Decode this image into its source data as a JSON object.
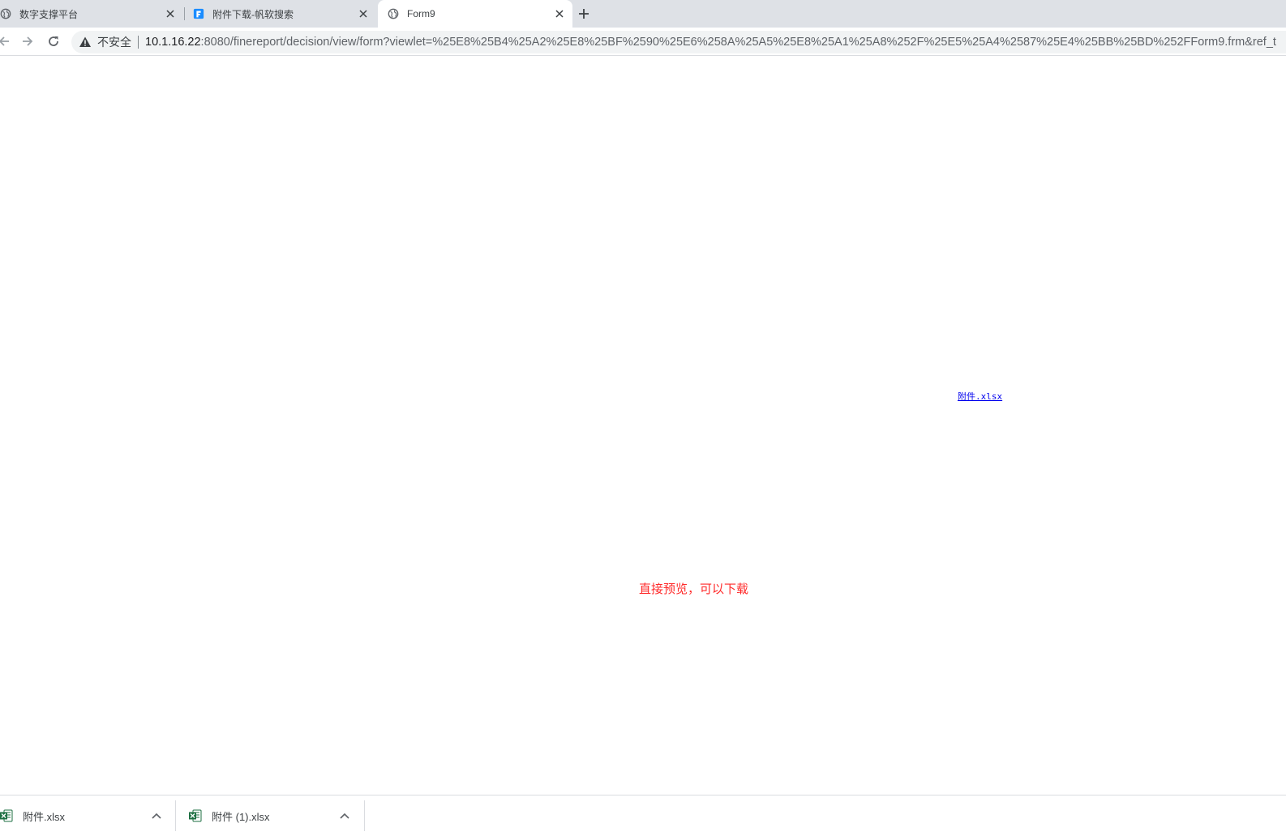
{
  "tabs": [
    {
      "title": "数字支撑平台",
      "icon": "globe-icon"
    },
    {
      "title": "附件下载-帆软搜索",
      "icon": "fanruan-logo-icon"
    },
    {
      "title": "Form9",
      "icon": "globe-icon",
      "active": true
    }
  ],
  "toolbar": {
    "security_label": "不安全",
    "url_host": "10.1.16.22",
    "url_rest": ":8080/finereport/decision/view/form?viewlet=%25E8%25B4%25A2%25E8%25BF%2590%25E6%258A%25A5%25E8%25A1%25A8%252F%25E5%25A4%2587%25E4%25BB%25BD%252FForm9.frm&ref_t"
  },
  "page": {
    "attachment_link": "附件.xlsx",
    "note": "直接预览，可以下载"
  },
  "downloads": [
    {
      "file_name": "附件.xlsx",
      "icon": "excel-file-icon"
    },
    {
      "file_name": "附件 (1).xlsx",
      "icon": "excel-file-icon"
    }
  ],
  "colors": {
    "tabstrip_bg": "#dee1e6",
    "link": "#0000ee",
    "note_text": "#ff2a2a",
    "excel_green": "#1d6f42",
    "fanruan_blue": "#1a8cff"
  }
}
